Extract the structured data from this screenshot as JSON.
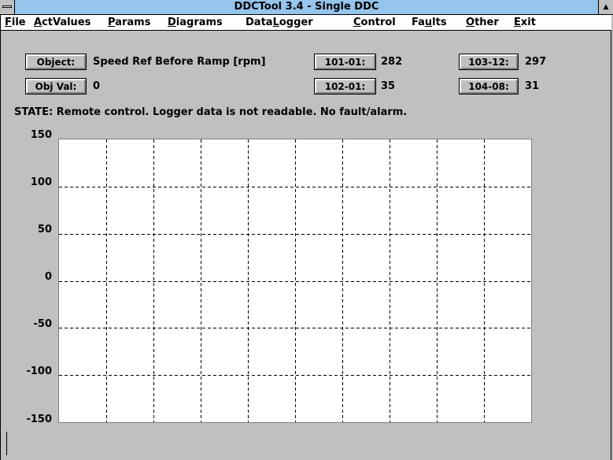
{
  "window": {
    "title": "DDCTool 3.4 - Single DDC",
    "maximize_glyph": "▲"
  },
  "menu": [
    {
      "label": "File",
      "key": "F",
      "rest": "ile"
    },
    {
      "label": "ActValues",
      "key": "A",
      "rest": "ctValues"
    },
    {
      "label": "Params",
      "key": "P",
      "rest": "arams"
    },
    {
      "label": "Diagrams",
      "key": "D",
      "rest": "iagrams"
    },
    {
      "label": "DataLogger",
      "pre": "Data",
      "key": "L",
      "rest": "ogger"
    },
    {
      "label": "Control",
      "key": "C",
      "rest": "ontrol"
    },
    {
      "label": "Faults",
      "pre": "Fa",
      "key": "u",
      "rest": "lts"
    },
    {
      "label": "Other",
      "key": "O",
      "rest": "ther"
    },
    {
      "label": "Exit",
      "key": "E",
      "rest": "xit"
    }
  ],
  "object": {
    "button_label": "Object:",
    "value": "Speed Ref Before Ramp [rpm]"
  },
  "obj_val": {
    "button_label": "Obj Val:",
    "value": "0"
  },
  "signals": [
    {
      "button_label": "101-01:",
      "value": "282"
    },
    {
      "button_label": "103-12:",
      "value": "297"
    },
    {
      "button_label": "102-01:",
      "value": "35"
    },
    {
      "button_label": "104-08:",
      "value": "31"
    }
  ],
  "status": "STATE: Remote control. Logger data is not readable. No fault/alarm.",
  "colors": {
    "titlebar": "#95c4ec",
    "window_bg": "#c0c0c0",
    "plot_bg": "#ffffff"
  },
  "chart_data": {
    "type": "line",
    "title": "",
    "xlabel": "",
    "ylabel": "",
    "ylim": [
      -150,
      150
    ],
    "y_ticks": [
      "150",
      "100",
      "50",
      "0",
      "-50",
      "-100",
      "-150"
    ],
    "x_divisions": 10,
    "grid": true,
    "series": []
  }
}
